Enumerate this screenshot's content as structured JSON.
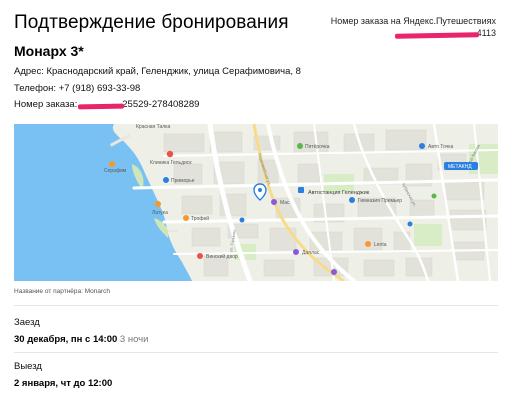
{
  "header": {
    "title": "Подтверждение бронирования",
    "order_label": "Номер заказа на Яндекс.Путешествиях",
    "order_number_hidden": "",
    "order_number_tail": "4113"
  },
  "hotel": {
    "name": "Монарх 3*",
    "address": "Адрес: Краснодарский край, Геленджик, улица Серафимовича, 8",
    "phone": "Телефон: +7 (918) 693-33-98",
    "order_prefix": "Номер заказа: ",
    "order_hidden": "",
    "order_tail": "25529-278408289"
  },
  "map": {
    "poi": {
      "krasnaya_talka": "Красная Талка",
      "pyaterochka": "Пятёрочка",
      "avto_tochka": "Авто Точка",
      "metaknd": "МЕТАКНД",
      "seraphim": "Серафим",
      "klinika": "Клиника Гельдиск",
      "primorye": "Приморье",
      "vokzal": "Автостанция Геленджик",
      "mac": "Мас",
      "gimnaz": "Гимназия Премьер",
      "latuka": "Латука",
      "trofey": "Трофей",
      "vinsky_dvor": "Винский двор",
      "dallas": "Даллас",
      "lenta": "Lenta"
    },
    "streets": {
      "s1": "улица Кирова",
      "s2": "Кубанская ул.",
      "s3": "ул. Горького",
      "s4": "Первомайская ул."
    }
  },
  "partner_note": "Название от партнёра: Monarch",
  "checkin": {
    "label": "Заезд",
    "date": "30 декабря, пн с 14:00",
    "nights": "3 ночи"
  },
  "checkout": {
    "label": "Выезд",
    "date": "2 января, чт до 12:00"
  },
  "colors": {
    "redaction": "#e8246a",
    "sea": "#79c1f2",
    "map_bg": "#eef0e8",
    "pin": "#2a7fe0"
  }
}
